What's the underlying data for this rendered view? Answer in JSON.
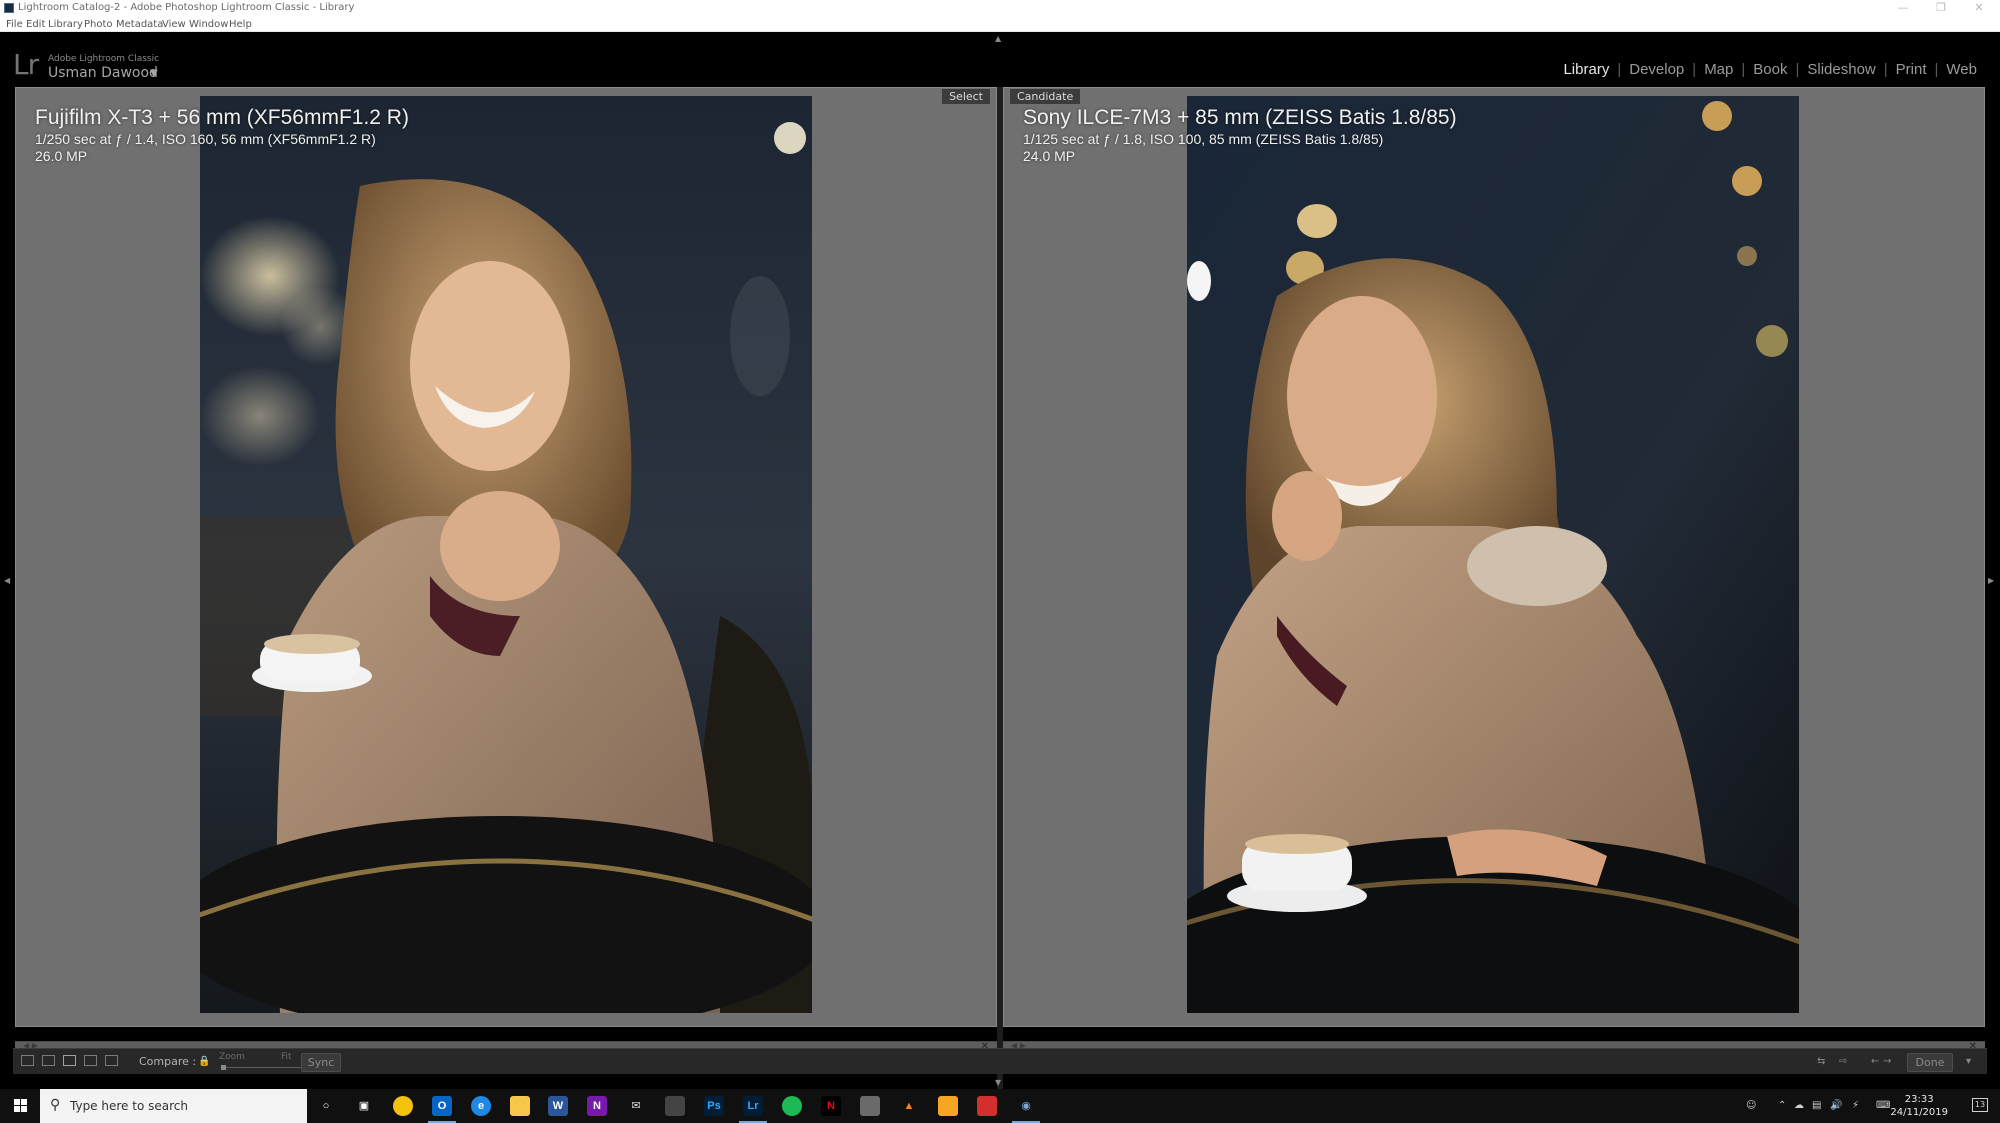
{
  "window": {
    "title": "Lightroom Catalog-2 - Adobe Photoshop Lightroom Classic - Library"
  },
  "menu": [
    "File",
    "Edit",
    "Library",
    "Photo",
    "Metadata",
    "View",
    "Window",
    "Help"
  ],
  "identity": {
    "logo": "Lr",
    "product": "Adobe Lightroom Classic",
    "user": "Usman Dawood"
  },
  "modules": {
    "items": [
      "Library",
      "Develop",
      "Map",
      "Book",
      "Slideshow",
      "Print",
      "Web"
    ],
    "active": "Library"
  },
  "compare": {
    "select": {
      "tag": "Select",
      "camera": "Fujifilm X-T3 + 56 mm (XF56mmF1.2 R)",
      "exif": "1/250 sec at ƒ / 1.4, ISO 160, 56 mm (XF56mmF1.2 R)",
      "megapixels": "26.0 MP"
    },
    "candidate": {
      "tag": "Candidate",
      "camera": "Sony ILCE-7M3 + 85 mm (ZEISS Batis 1.8/85)",
      "exif": "1/125 sec at ƒ / 1.8, ISO 100, 85 mm (ZEISS Batis 1.8/85)",
      "megapixels": "24.0 MP"
    }
  },
  "toolbar": {
    "compare_label": "Compare :",
    "zoom_label": "Zoom",
    "fit_label": "Fit",
    "sync_label": "Sync",
    "done_label": "Done"
  },
  "taskbar": {
    "search_placeholder": "Type here to search",
    "time": "23:33",
    "date": "24/11/2019",
    "notification_count": "13",
    "colors": {
      "chrome": "#f4c20d",
      "outlook": "#0a64c8",
      "edge": "#1e88e5",
      "explorer": "#f7c64a",
      "word": "#2b579a",
      "onenote": "#7719aa",
      "photoshop": "#001e36",
      "lightroom": "#001d34",
      "spotify": "#1db954",
      "netflix": "#e50914"
    }
  }
}
